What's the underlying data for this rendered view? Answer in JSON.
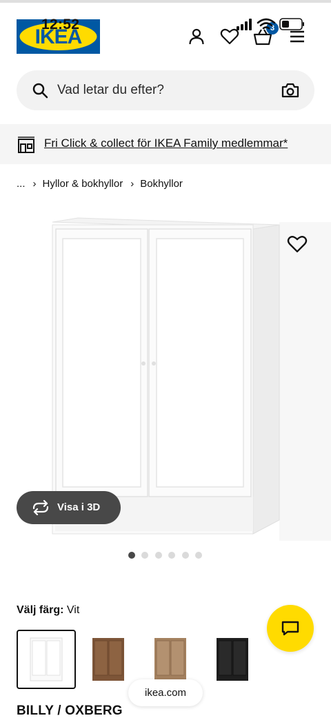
{
  "status_bar": {
    "time": "12:52",
    "icons": [
      "cellular-signal-icon",
      "wifi-icon",
      "battery-icon"
    ]
  },
  "header": {
    "logo_text": "IKEA",
    "icons": [
      "user-icon",
      "heart-icon",
      "basket-icon",
      "menu-icon"
    ],
    "cart_count": "3"
  },
  "search": {
    "placeholder": "Vad letar du efter?",
    "icons": [
      "search-icon",
      "camera-icon"
    ]
  },
  "promo": {
    "text": "Fri Click & collect för IKEA Family medlemmar*",
    "icon": "store-icon"
  },
  "breadcrumb": {
    "items": [
      "...",
      "Hyllor & bokhyllor",
      "Bokhyllor"
    ]
  },
  "product": {
    "view_3d_label": "Visa i 3D",
    "image_count": 6,
    "active_image": 1,
    "color_label": "Välj färg:",
    "color_value": "Vit",
    "swatches": [
      "white",
      "walnut-brown",
      "oak-effect",
      "black"
    ],
    "title": "BILLY / OXBERG"
  },
  "browser": {
    "url": "ikea.com"
  },
  "colors": {
    "ikea_blue": "#0058a3",
    "ikea_yellow": "#ffdb00",
    "dark_button": "#484848"
  }
}
